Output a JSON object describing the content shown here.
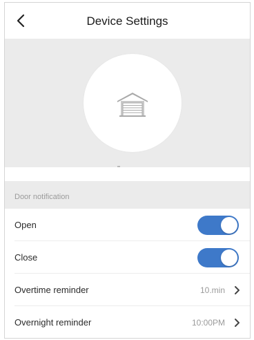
{
  "header": {
    "title": "Device Settings",
    "back_icon": "chevron-left-icon"
  },
  "hero": {
    "icon": "garage-door-icon"
  },
  "notification_section": {
    "label": "Door notification",
    "rows": [
      {
        "label": "Open",
        "control": "toggle",
        "on": true
      },
      {
        "label": "Close",
        "control": "toggle",
        "on": true
      },
      {
        "label": "Overtime reminder",
        "control": "value",
        "value": "10.min"
      },
      {
        "label": "Overnight reminder",
        "control": "value",
        "value": "10:00PM"
      }
    ]
  },
  "colors": {
    "accent": "#3e79c9",
    "section_background": "#ebebeb",
    "secondary_text": "#9a9a9a"
  }
}
